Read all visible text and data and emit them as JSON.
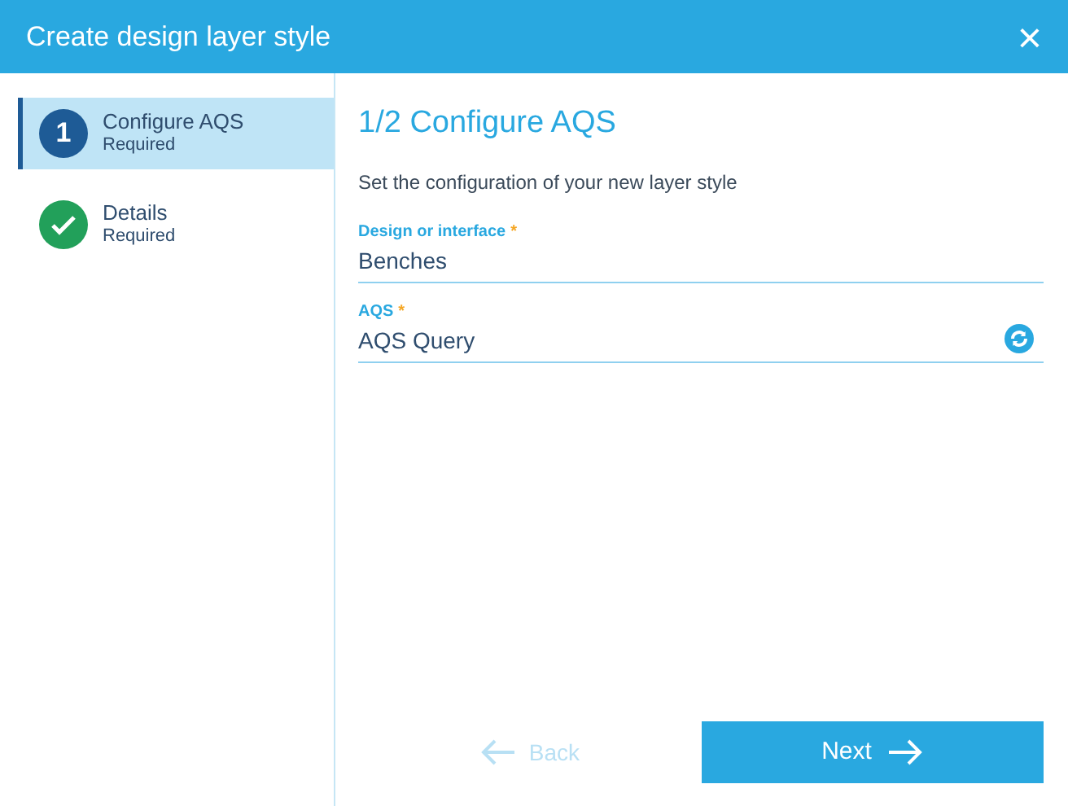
{
  "window": {
    "title": "Create design layer style",
    "close": "×"
  },
  "steps": [
    {
      "number": "1",
      "title": "Configure AQS",
      "subtitle": "Required",
      "selected": true,
      "complete": false
    },
    {
      "title": "Details",
      "subtitle": "Required",
      "selected": false,
      "complete": true
    }
  ],
  "heading": "1/2 Configure AQS",
  "description": "Set the configuration of your new layer style",
  "fields": [
    {
      "kind": "text",
      "label": "Design or interface",
      "required_mark": "*",
      "value": "Benches"
    },
    {
      "kind": "query",
      "label": "AQS",
      "required_mark": "*",
      "value": "AQS Query"
    }
  ],
  "buttons": [
    {
      "kind": "back",
      "label": "Back",
      "disabled": true
    },
    {
      "kind": "next",
      "label": "Next",
      "disabled": false
    }
  ]
}
